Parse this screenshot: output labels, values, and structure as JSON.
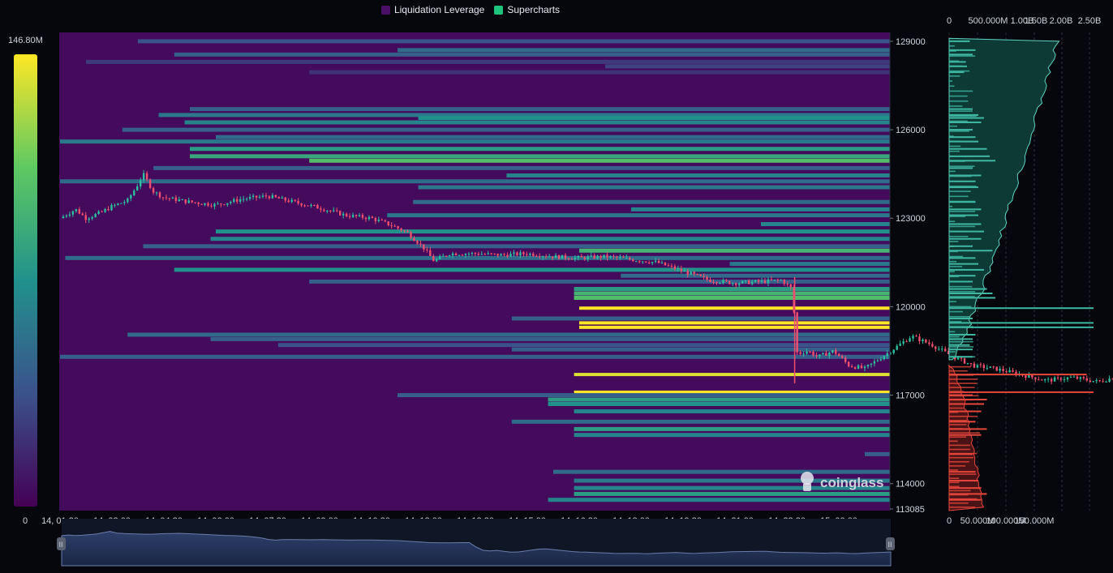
{
  "legend": {
    "items": [
      {
        "label": "Liquidation Leverage",
        "color": "#4a1068"
      },
      {
        "label": "Supercharts",
        "color": "#1ec47e"
      }
    ]
  },
  "colorbar": {
    "max_label": "146.80M",
    "min_label": "0"
  },
  "watermark": "coinglass",
  "colors": {
    "background": "#05070d",
    "heatmap_base": "#440a5c",
    "candle_up": "#2bc0a0",
    "candle_down": "#f0506e",
    "long_liq": "#3fb8a2",
    "short_liq": "#e8463c"
  },
  "chart_data": [
    {
      "type": "heatmap",
      "title": "",
      "x_ticks": [
        "14, 01:30",
        "14, 03:00",
        "14, 04:30",
        "14, 06:00",
        "14, 07:30",
        "14, 09:00",
        "14, 10:30",
        "14, 12:00",
        "14, 13:30",
        "14, 15:00",
        "14, 16:30",
        "14, 18:00",
        "14, 19:30",
        "14, 21:00",
        "14, 22:30",
        "15, 00:00"
      ],
      "y_ticks": [
        129000,
        126000,
        123000,
        120000,
        117000,
        114000,
        113085
      ],
      "ylim": [
        113085,
        129300
      ],
      "color_scale": {
        "min": 0,
        "max": "146.80M"
      },
      "liquidation_bands": [
        {
          "price": 129000,
          "start": 1.5,
          "intensity": 0.25
        },
        {
          "price": 128700,
          "start": 6.5,
          "intensity": 0.35
        },
        {
          "price": 128550,
          "start": 2.2,
          "intensity": 0.3
        },
        {
          "price": 128300,
          "start": 0.5,
          "intensity": 0.18
        },
        {
          "price": 128150,
          "start": 10.5,
          "intensity": 0.2
        },
        {
          "price": 127950,
          "start": 4.8,
          "intensity": 0.15
        },
        {
          "price": 126700,
          "start": 2.5,
          "intensity": 0.3
        },
        {
          "price": 126500,
          "start": 1.9,
          "intensity": 0.4
        },
        {
          "price": 126400,
          "start": 6.9,
          "intensity": 0.5
        },
        {
          "price": 126250,
          "start": 2.4,
          "intensity": 0.45
        },
        {
          "price": 126000,
          "start": 1.2,
          "intensity": 0.3
        },
        {
          "price": 125750,
          "start": 3.0,
          "intensity": 0.35
        },
        {
          "price": 125600,
          "start": 0.0,
          "intensity": 0.4
        },
        {
          "price": 125350,
          "start": 2.5,
          "intensity": 0.55
        },
        {
          "price": 125100,
          "start": 2.5,
          "intensity": 0.6
        },
        {
          "price": 124950,
          "start": 4.8,
          "intensity": 0.7
        },
        {
          "price": 124700,
          "start": 1.8,
          "intensity": 0.3
        },
        {
          "price": 124450,
          "start": 8.6,
          "intensity": 0.45
        },
        {
          "price": 124250,
          "start": 0.0,
          "intensity": 0.35
        },
        {
          "price": 124050,
          "start": 6.9,
          "intensity": 0.4
        },
        {
          "price": 123550,
          "start": 6.8,
          "intensity": 0.35
        },
        {
          "price": 123300,
          "start": 11.0,
          "intensity": 0.45
        },
        {
          "price": 123100,
          "start": 6.3,
          "intensity": 0.4
        },
        {
          "price": 122800,
          "start": 13.5,
          "intensity": 0.45
        },
        {
          "price": 122550,
          "start": 3.0,
          "intensity": 0.5
        },
        {
          "price": 122300,
          "start": 2.9,
          "intensity": 0.45
        },
        {
          "price": 122050,
          "start": 1.6,
          "intensity": 0.3
        },
        {
          "price": 121900,
          "start": 10.0,
          "intensity": 0.65
        },
        {
          "price": 121650,
          "start": 0.1,
          "intensity": 0.35
        },
        {
          "price": 121450,
          "start": 12.9,
          "intensity": 0.4
        },
        {
          "price": 121250,
          "start": 2.2,
          "intensity": 0.5
        },
        {
          "price": 121050,
          "start": 10.8,
          "intensity": 0.35
        },
        {
          "price": 120850,
          "start": 4.8,
          "intensity": 0.3
        },
        {
          "price": 120600,
          "start": 9.9,
          "intensity": 0.55
        },
        {
          "price": 120450,
          "start": 9.9,
          "intensity": 0.65
        },
        {
          "price": 120300,
          "start": 9.9,
          "intensity": 0.7
        },
        {
          "price": 119950,
          "start": 10.0,
          "intensity": 1.0
        },
        {
          "price": 119600,
          "start": 8.7,
          "intensity": 0.3
        },
        {
          "price": 119450,
          "start": 10.0,
          "intensity": 1.0
        },
        {
          "price": 119300,
          "start": 10.0,
          "intensity": 1.0
        },
        {
          "price": 119050,
          "start": 1.3,
          "intensity": 0.35
        },
        {
          "price": 118900,
          "start": 2.9,
          "intensity": 0.3
        },
        {
          "price": 118700,
          "start": 4.2,
          "intensity": 0.25
        },
        {
          "price": 118550,
          "start": 8.7,
          "intensity": 0.3
        },
        {
          "price": 118300,
          "start": 0.0,
          "intensity": 0.3
        },
        {
          "price": 117700,
          "start": 9.9,
          "intensity": 0.95
        },
        {
          "price": 117100,
          "start": 9.9,
          "intensity": 1.0
        },
        {
          "price": 117000,
          "start": 6.5,
          "intensity": 0.3
        },
        {
          "price": 116850,
          "start": 9.4,
          "intensity": 0.55
        },
        {
          "price": 116700,
          "start": 9.4,
          "intensity": 0.5
        },
        {
          "price": 116450,
          "start": 9.9,
          "intensity": 0.45
        },
        {
          "price": 116100,
          "start": 8.7,
          "intensity": 0.35
        },
        {
          "price": 115850,
          "start": 9.9,
          "intensity": 0.55
        },
        {
          "price": 115650,
          "start": 9.9,
          "intensity": 0.45
        },
        {
          "price": 115000,
          "start": 15.5,
          "intensity": 0.3
        },
        {
          "price": 114400,
          "start": 9.5,
          "intensity": 0.35
        },
        {
          "price": 114100,
          "start": 9.9,
          "intensity": 0.4
        },
        {
          "price": 113850,
          "start": 9.9,
          "intensity": 0.45
        },
        {
          "price": 113650,
          "start": 9.9,
          "intensity": 0.55
        },
        {
          "price": 113450,
          "start": 9.4,
          "intensity": 0.45
        }
      ],
      "price_path": [
        [
          0.0,
          123000
        ],
        [
          0.3,
          123300
        ],
        [
          0.5,
          123000
        ],
        [
          0.8,
          123200
        ],
        [
          1.0,
          123400
        ],
        [
          1.3,
          123600
        ],
        [
          1.5,
          124150
        ],
        [
          1.6,
          124500
        ],
        [
          1.8,
          123900
        ],
        [
          2.0,
          123700
        ],
        [
          2.5,
          123550
        ],
        [
          3.0,
          123450
        ],
        [
          3.5,
          123650
        ],
        [
          4.0,
          123750
        ],
        [
          4.5,
          123550
        ],
        [
          5.0,
          123350
        ],
        [
          5.5,
          123100
        ],
        [
          6.0,
          123000
        ],
        [
          6.4,
          122750
        ],
        [
          6.7,
          122500
        ],
        [
          7.0,
          122000
        ],
        [
          7.2,
          121550
        ],
        [
          7.5,
          121800
        ],
        [
          8.0,
          121800
        ],
        [
          8.5,
          121750
        ],
        [
          9.0,
          121800
        ],
        [
          9.5,
          121700
        ],
        [
          10.0,
          121650
        ],
        [
          10.5,
          121700
        ],
        [
          11.0,
          121600
        ],
        [
          11.5,
          121500
        ],
        [
          12.0,
          121200
        ],
        [
          12.5,
          120900
        ],
        [
          13.0,
          120800
        ],
        [
          13.5,
          120850
        ],
        [
          13.9,
          120900
        ],
        [
          14.1,
          120600
        ],
        [
          14.2,
          118400
        ],
        [
          14.4,
          118500
        ],
        [
          14.6,
          118300
        ],
        [
          14.9,
          118500
        ],
        [
          15.2,
          118000
        ],
        [
          15.5,
          117900
        ],
        [
          16.0,
          118500
        ],
        [
          16.4,
          119000
        ],
        [
          16.8,
          118700
        ],
        [
          17.2,
          118300
        ],
        [
          17.6,
          118000
        ],
        [
          18.0,
          117900
        ],
        [
          18.5,
          117700
        ],
        [
          19.0,
          117500
        ],
        [
          19.5,
          117600
        ],
        [
          20.0,
          117450
        ],
        [
          20.5,
          117700
        ],
        [
          21.0,
          117800
        ],
        [
          21.5,
          117550
        ],
        [
          22.0,
          117700
        ],
        [
          22.5,
          117850
        ],
        [
          23.0,
          118100
        ],
        [
          23.5,
          118150
        ],
        [
          24.0,
          118200
        ],
        [
          24.5,
          117900
        ],
        [
          25.0,
          117800
        ],
        [
          25.5,
          117750
        ],
        [
          26.0,
          117600
        ],
        [
          26.5,
          117750
        ],
        [
          27.0,
          117450
        ],
        [
          27.5,
          117700
        ],
        [
          28.0,
          117850
        ],
        [
          28.3,
          118000
        ]
      ]
    },
    {
      "type": "bar",
      "title": "",
      "axis_ticks": [
        "0",
        "500.000M",
        "1.00B",
        "1.50B",
        "2.00B",
        "2.50B"
      ],
      "note": "cumulative liquidation leverage profile by price"
    },
    {
      "type": "bar",
      "title": "",
      "axis_ticks": [
        "0",
        "50.000M",
        "100.000M",
        "150.000M"
      ],
      "note": "liquidation leverage volume by price level"
    }
  ]
}
